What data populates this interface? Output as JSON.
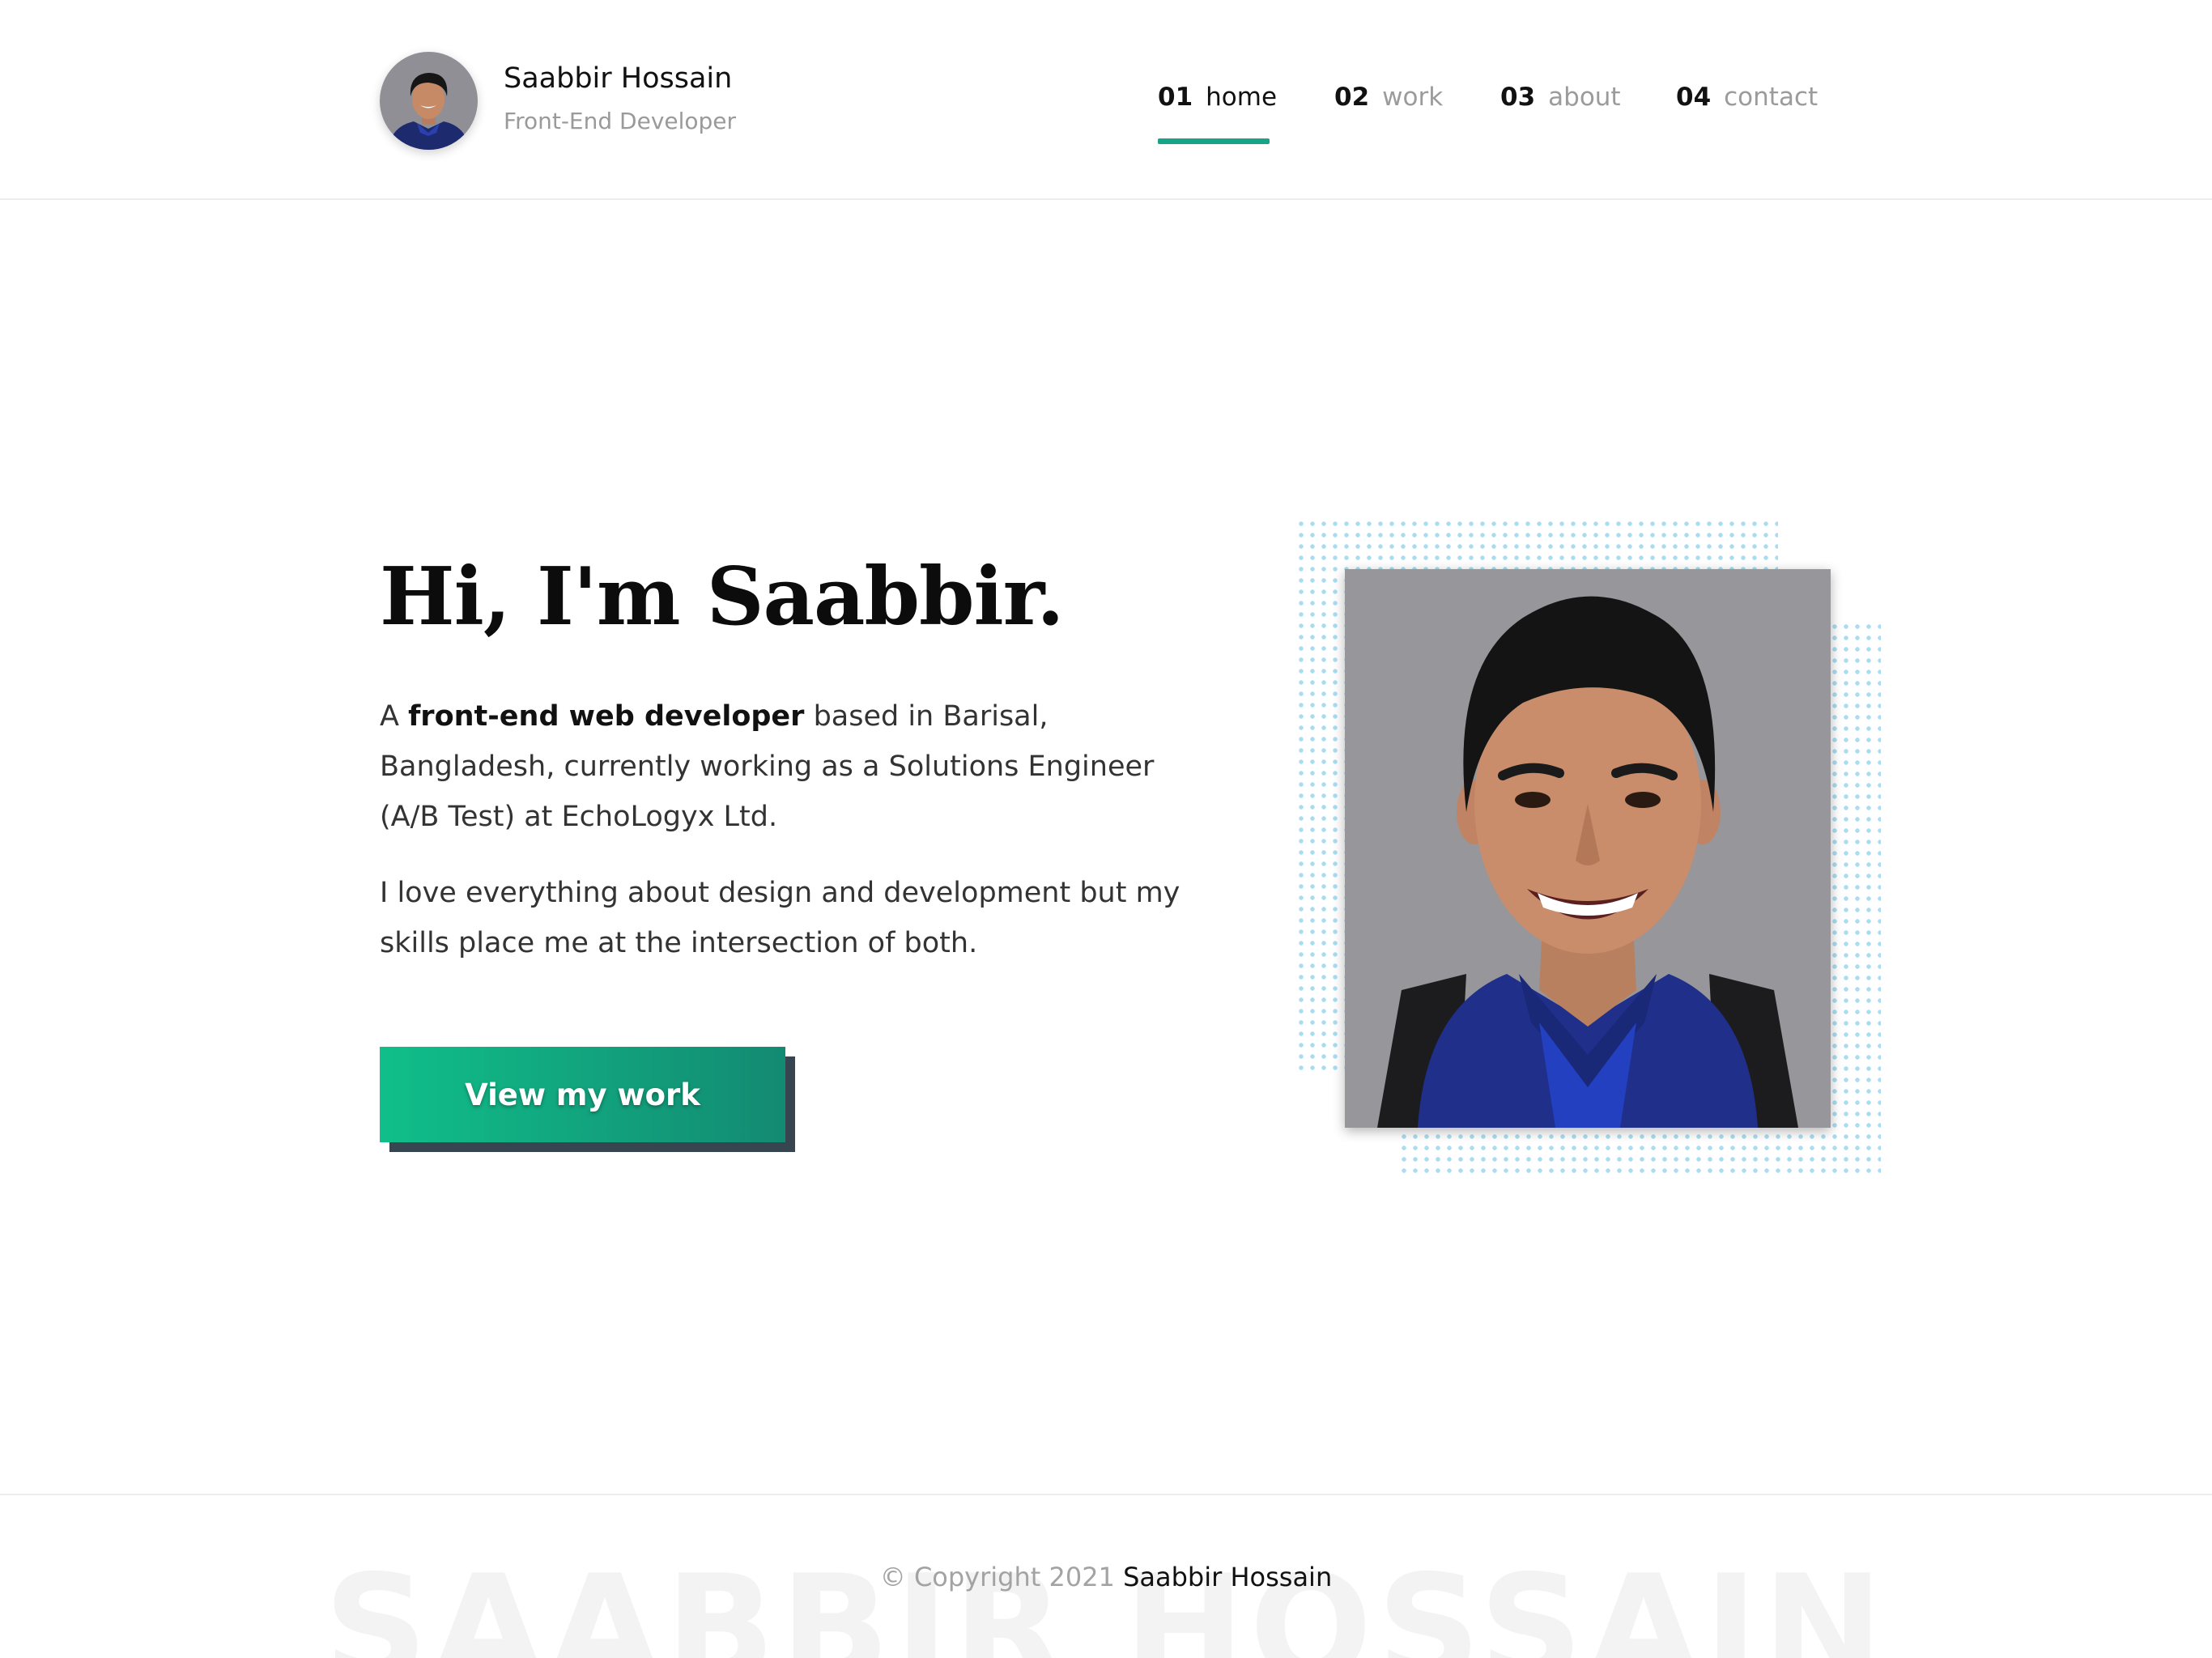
{
  "header": {
    "name": "Saabbir Hossain",
    "role": "Front-End Developer",
    "nav": [
      {
        "num": "01",
        "label": "home",
        "active": true
      },
      {
        "num": "02",
        "label": "work",
        "active": false
      },
      {
        "num": "03",
        "label": "about",
        "active": false
      },
      {
        "num": "04",
        "label": "contact",
        "active": false
      }
    ]
  },
  "hero": {
    "title": "Hi, I'm Saabbir.",
    "para1": {
      "prefix": "A ",
      "highlight": "front-end web developer",
      "suffix": " based in Barisal, Bangladesh, currently working as a Solutions Engineer (A/B Test) at EchoLogyx Ltd."
    },
    "para2": "I love everything about design and development but my skills place me at the intersection of both.",
    "cta_label": "View my work"
  },
  "footer": {
    "watermark": "SAABBIR HOSSAIN",
    "copyright": "© Copyright 2021",
    "owner": "Saabbir Hossain"
  },
  "colors": {
    "accent": "#17a589",
    "cta_gradient_start": "#10bf8a",
    "cta_gradient_end": "#138a72",
    "cta_shadow": "#36454f",
    "dots": "#a9dcef"
  },
  "icons": {
    "avatar": "profile-photo",
    "portrait": "portrait-photo"
  }
}
